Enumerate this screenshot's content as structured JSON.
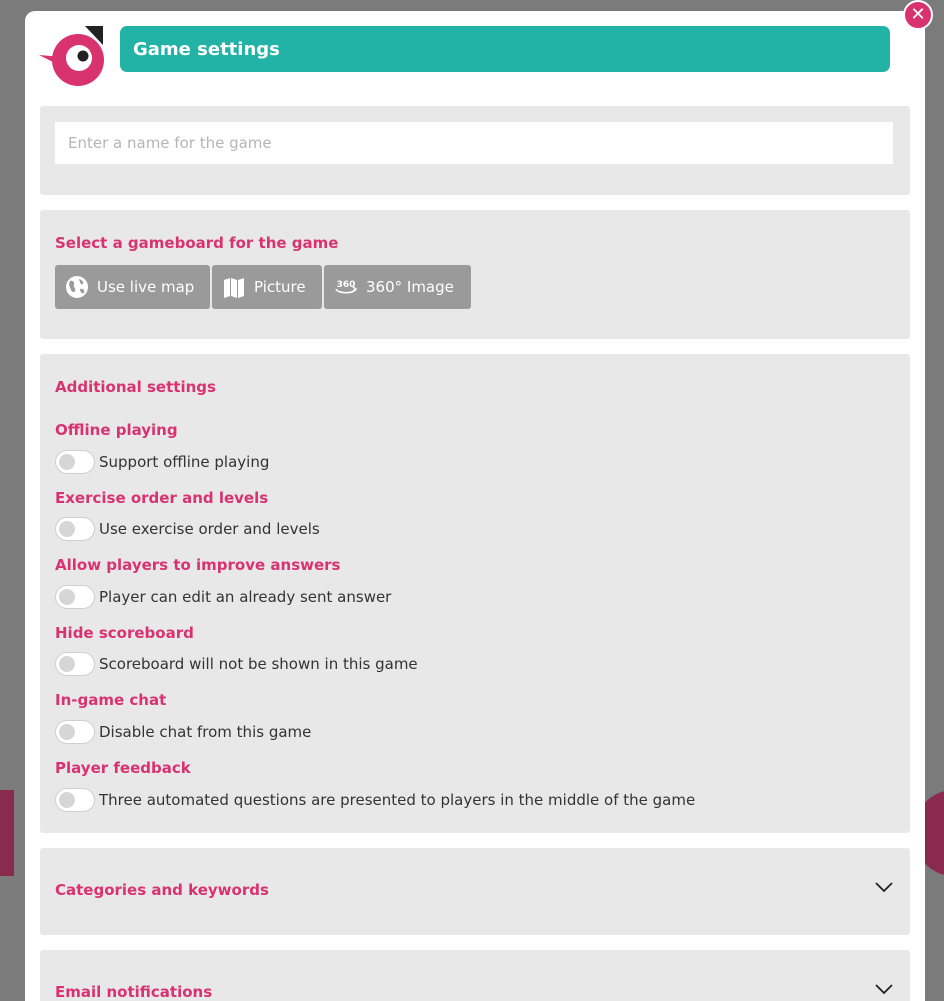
{
  "header": {
    "title": "Game settings"
  },
  "name_input": {
    "placeholder": "Enter a name for the game",
    "value": ""
  },
  "gameboard": {
    "title": "Select a gameboard for the game",
    "options": [
      {
        "label": "Use live map",
        "icon": "globe-icon"
      },
      {
        "label": "Picture",
        "icon": "map-icon"
      },
      {
        "label": "360° Image",
        "icon": "360-icon"
      }
    ]
  },
  "additional": {
    "title": "Additional settings",
    "settings": [
      {
        "title": "Offline playing",
        "label": "Support offline playing",
        "enabled": false
      },
      {
        "title": "Exercise order and levels",
        "label": "Use exercise order and levels",
        "enabled": false
      },
      {
        "title": "Allow players to improve answers",
        "label": "Player can edit an already sent answer",
        "enabled": false
      },
      {
        "title": "Hide scoreboard",
        "label": "Scoreboard will not be shown in this game",
        "enabled": false
      },
      {
        "title": "In-game chat",
        "label": "Disable chat from this game",
        "enabled": false
      },
      {
        "title": "Player feedback",
        "label": "Three automated questions are presented to players in the middle of the game",
        "enabled": false
      }
    ]
  },
  "categories": {
    "title": "Categories and keywords"
  },
  "email_notifications": {
    "title": "Email notifications"
  },
  "colors": {
    "accent_pink": "#d9336f",
    "teal": "#22b2a6",
    "panel_gray": "#e8e8e8",
    "button_gray": "#9a9a9a"
  }
}
